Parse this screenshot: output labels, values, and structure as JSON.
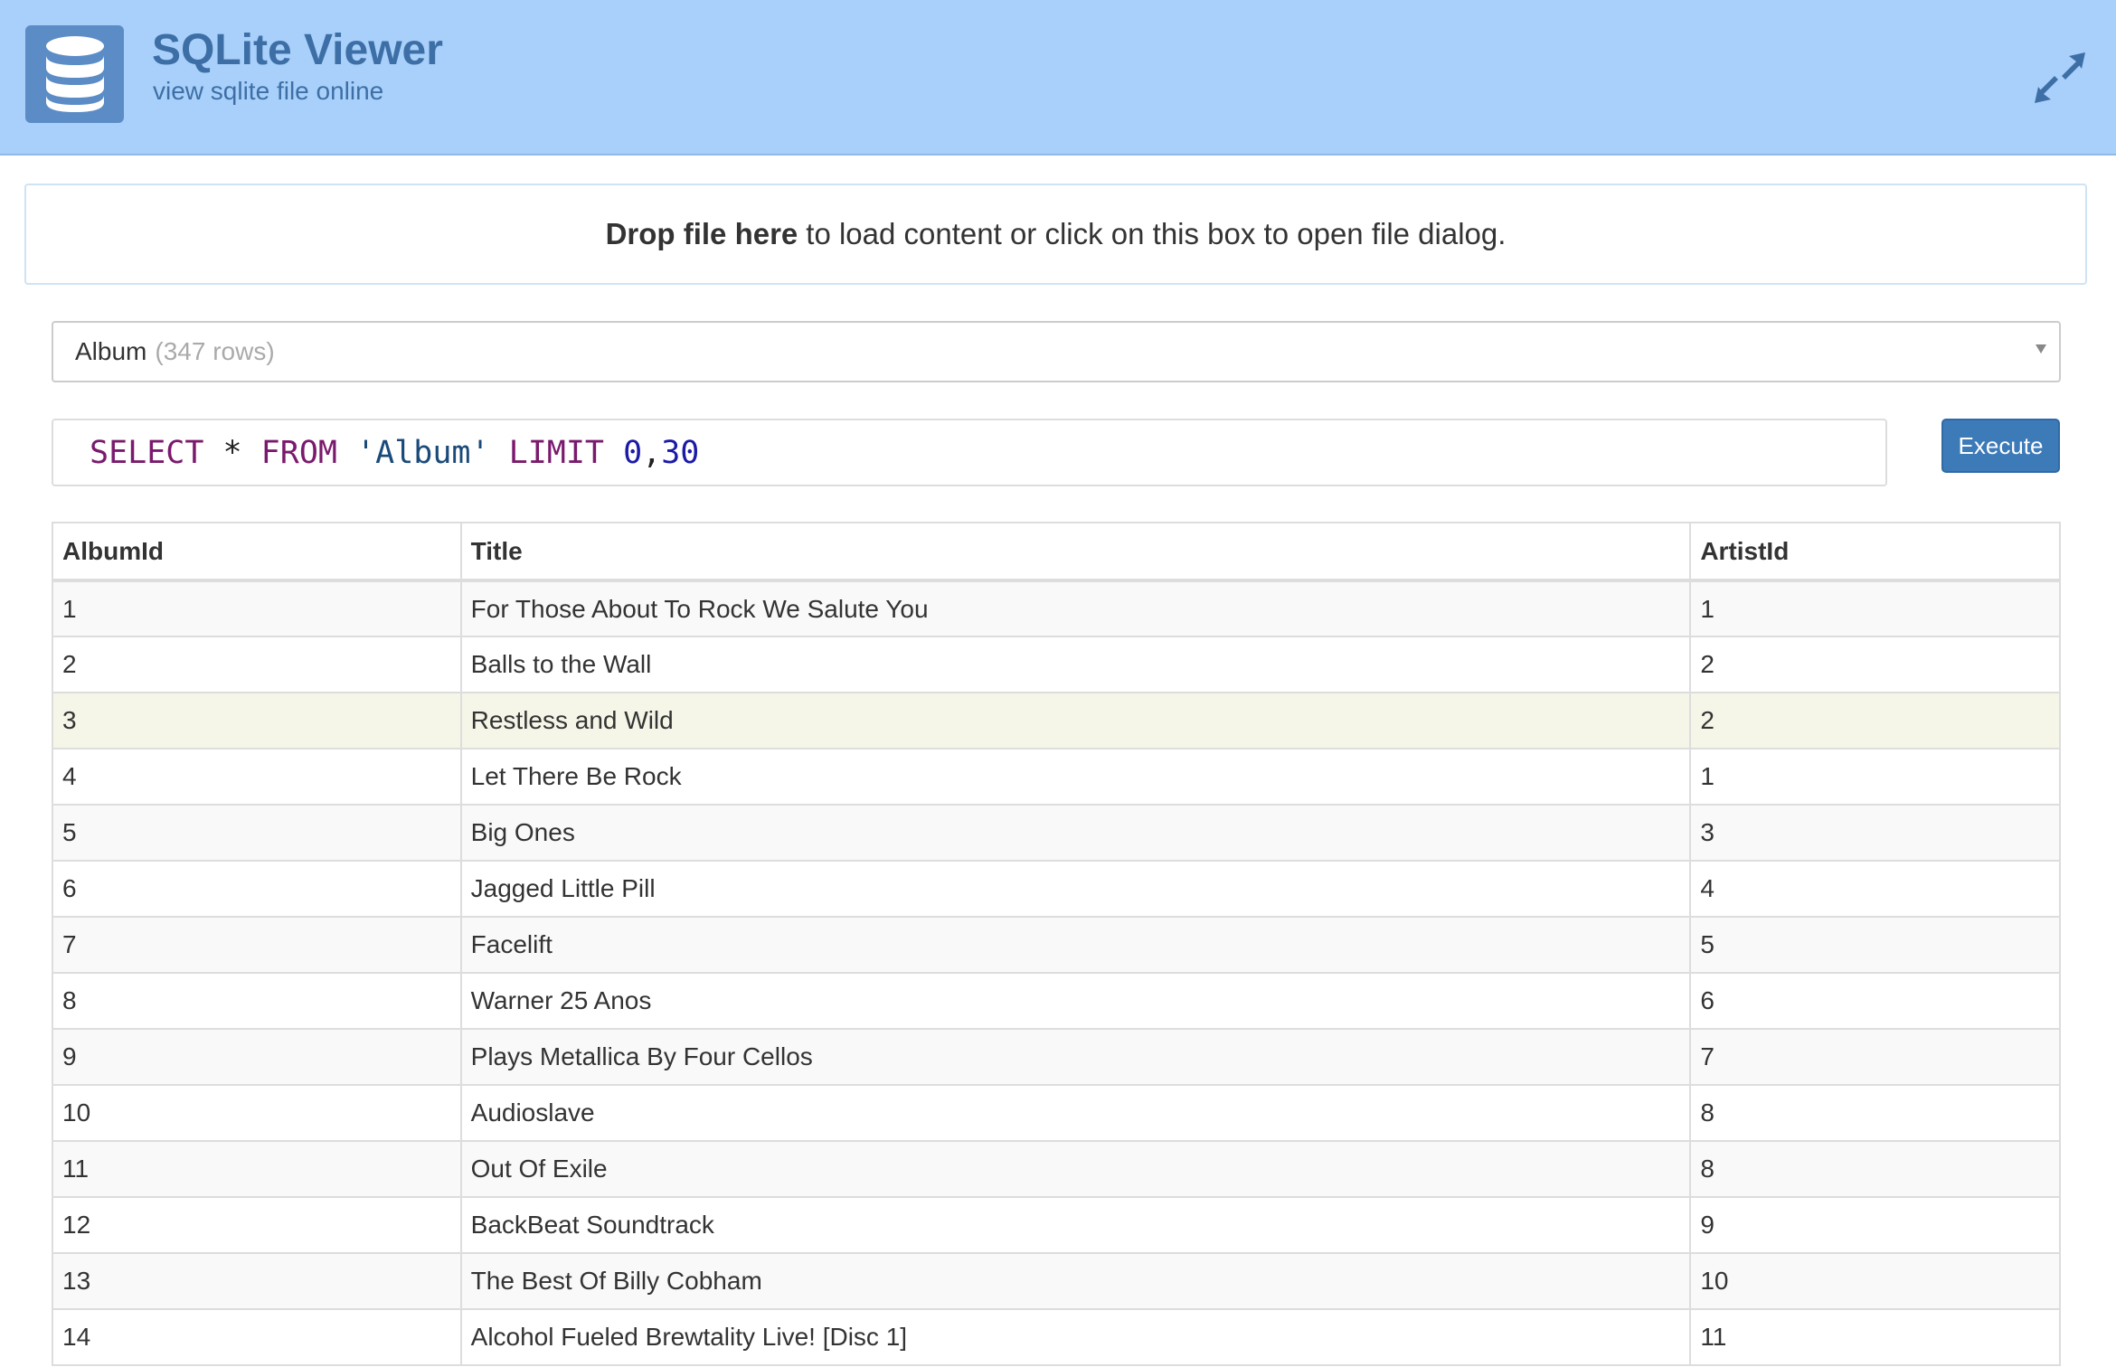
{
  "header": {
    "title": "SQLite Viewer",
    "subtitle": "view sqlite file online",
    "logo_icon": "database-icon",
    "expand_icon": "expand-arrows-icon",
    "bg_color": "#a9d0fa"
  },
  "dropzone": {
    "bold_text": "Drop file here",
    "text": "to load content or click on this box to open file dialog."
  },
  "table_select": {
    "name": "Album",
    "row_count": "(347 rows)"
  },
  "query": {
    "select": "SELECT",
    "star": "*",
    "from": "FROM",
    "table": "'Album'",
    "limit": "LIMIT",
    "offset": "0",
    "comma": ",",
    "count": "30"
  },
  "execute_label": "Execute",
  "results": {
    "columns": [
      "AlbumId",
      "Title",
      "ArtistId"
    ],
    "rows": [
      [
        "1",
        "For Those About To Rock We Salute You",
        "1"
      ],
      [
        "2",
        "Balls to the Wall",
        "2"
      ],
      [
        "3",
        "Restless and Wild",
        "2"
      ],
      [
        "4",
        "Let There Be Rock",
        "1"
      ],
      [
        "5",
        "Big Ones",
        "3"
      ],
      [
        "6",
        "Jagged Little Pill",
        "4"
      ],
      [
        "7",
        "Facelift",
        "5"
      ],
      [
        "8",
        "Warner 25 Anos",
        "6"
      ],
      [
        "9",
        "Plays Metallica By Four Cellos",
        "7"
      ],
      [
        "10",
        "Audioslave",
        "8"
      ],
      [
        "11",
        "Out Of Exile",
        "8"
      ],
      [
        "12",
        "BackBeat Soundtrack",
        "9"
      ],
      [
        "13",
        "The Best Of Billy Cobham",
        "10"
      ],
      [
        "14",
        "Alcohol Fueled Brewtality Live! [Disc 1]",
        "11"
      ]
    ],
    "hover_row": 2
  }
}
